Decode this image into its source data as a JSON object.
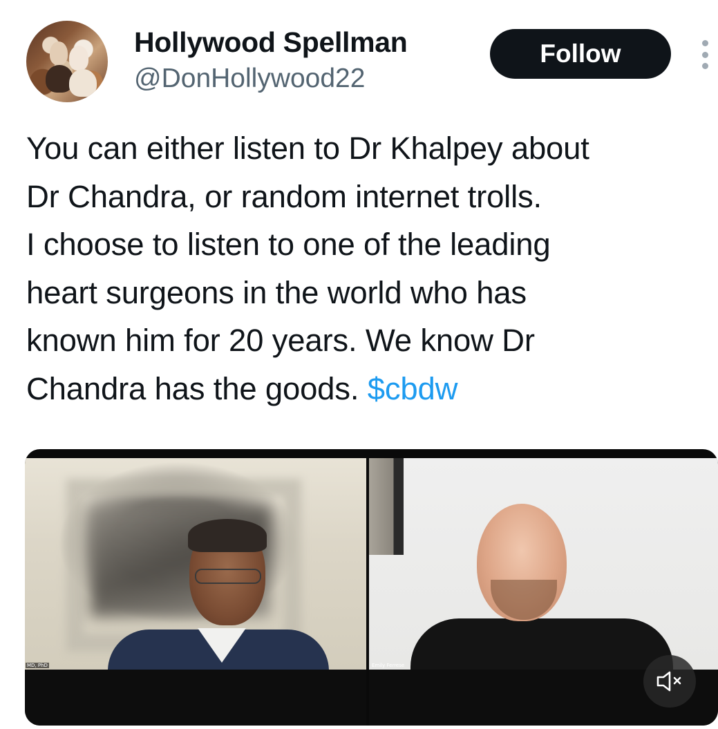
{
  "author": {
    "display_name": "Hollywood Spellman",
    "handle": "@DonHollywood22",
    "avatar_icon": "profile-photo"
  },
  "header": {
    "follow_label": "Follow",
    "more_icon": "more-vertical-icon"
  },
  "tweet": {
    "lines": [
      "You can either listen to Dr Khalpey about",
      "Dr Chandra, or random internet trolls.",
      "I choose to listen to one of the leading",
      "heart surgeons in the world who has",
      "known him for 20 years. We know Dr",
      "Chandra has the goods."
    ],
    "cashtag": "$cbdw",
    "link_color": "#1d9bf0"
  },
  "media": {
    "left_caption": "MD, PhD",
    "right_caption": "Emily Ferrese",
    "mute_icon": "speaker-muted-icon"
  },
  "colors": {
    "text": "#0f1419",
    "secondary": "#536471",
    "button_bg": "#0f1419",
    "button_text": "#ffffff"
  }
}
